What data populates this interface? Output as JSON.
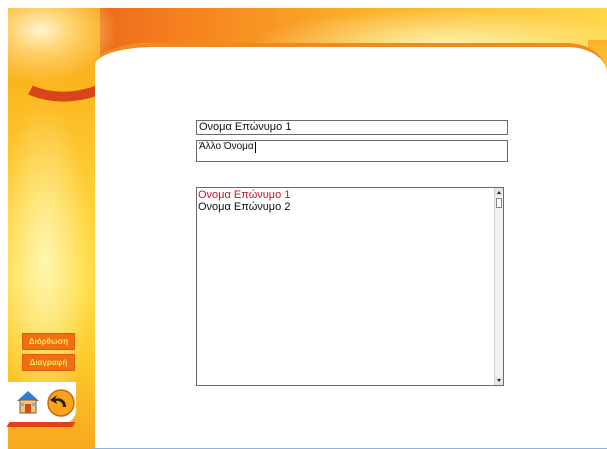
{
  "fields": {
    "primary_value": "Ονομα Επώνυμο 1",
    "secondary_value": "Άλλο Όνομα"
  },
  "list": {
    "items": [
      {
        "label": "Ονομα Επώνυμο 1",
        "selected": true
      },
      {
        "label": "Ονομα Επώνυμο 2",
        "selected": false
      }
    ]
  },
  "sidebar": {
    "edit_label": "Διόρθωση",
    "delete_label": "Διαγραφή"
  },
  "icons": {
    "home": "home-icon",
    "back": "back-arrow-icon"
  },
  "colors": {
    "accent_orange": "#f16f13",
    "selected_text": "#c4161c",
    "button_text": "#ffe45a"
  }
}
